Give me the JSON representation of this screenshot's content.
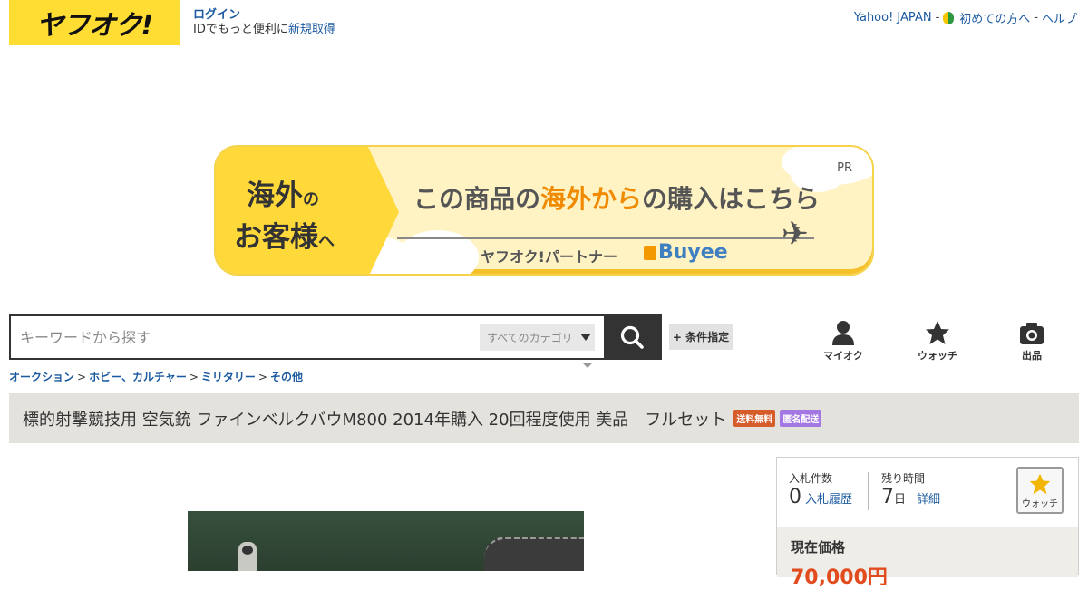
{
  "header": {
    "logo_text": "ヤフオク!",
    "login_label": "ログイン",
    "login_sub_prefix": "IDでもっと便利に",
    "register_label": "新規取得",
    "yahoo_japan": "Yahoo! JAPAN",
    "dash1": "-",
    "beginner_label": "初めての方へ",
    "dash2": "-",
    "help_label": "ヘルプ"
  },
  "banner": {
    "left_line1": "海外",
    "left_line1_small": "の",
    "left_line2": "お客様",
    "left_line2_small": "へ",
    "pr": "PR",
    "headline_pre": "この商品の",
    "headline_highlight": "海外から",
    "headline_post": "の購入はこちら",
    "partner": "ヤフオク!パートナー",
    "buyee": "Buyee"
  },
  "search": {
    "placeholder": "キーワードから探す",
    "category_label": "すべてのカテゴリ",
    "conditions_label": "+ 条件指定"
  },
  "nav_icons": {
    "myauc": "マイオク",
    "watch": "ウォッチ",
    "sell": "出品"
  },
  "breadcrumb": [
    "オークション",
    "ホビー、カルチャー",
    "ミリタリー",
    "その他"
  ],
  "breadcrumb_sep": ">",
  "item": {
    "title": "標的射撃競技用 空気銃 ファインベルクバウM800 2014年購入 20回程度使用 美品　フルセット",
    "badge_shipping": "送料無料",
    "badge_anonymous": "匿名配送"
  },
  "bid_panel": {
    "bids_label": "入札件数",
    "bids_value": "0",
    "bids_history": "入札履歴",
    "time_label": "残り時間",
    "time_value": "7",
    "time_unit": "日",
    "time_detail": "詳細",
    "watch_label": "ウォッチ",
    "price_label": "現在価格",
    "price_value": "70,000円"
  },
  "colors": {
    "brand_yellow": "#ffdd33",
    "link_blue": "#1c5aa0",
    "badge_shipping": "#d65c2a",
    "badge_anonymous": "#a478e3",
    "price_red": "#e14b1d"
  }
}
